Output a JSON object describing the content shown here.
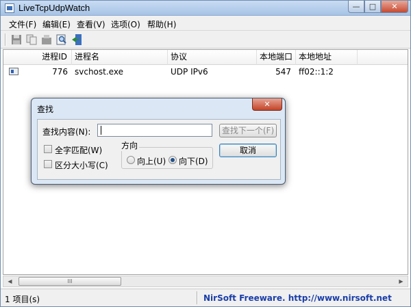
{
  "window": {
    "title": "LiveTcpUdpWatch",
    "minimize_glyph": "—",
    "maximize_glyph": "□",
    "close_glyph": "✕"
  },
  "menu": {
    "items": [
      {
        "label": "文件(F)"
      },
      {
        "label": "编辑(E)"
      },
      {
        "label": "查看(V)"
      },
      {
        "label": "选项(O)"
      },
      {
        "label": "帮助(H)"
      }
    ]
  },
  "toolbar": {
    "icons": [
      "save-icon",
      "copy-icon",
      "properties-icon",
      "find-icon",
      "exit-icon"
    ]
  },
  "list": {
    "columns": [
      "进程ID",
      "进程名",
      "协议",
      "本地端口",
      "本地地址"
    ],
    "rows": [
      {
        "pid": "776",
        "name": "svchost.exe",
        "protocol": "UDP IPv6",
        "local_port": "547",
        "local_address": "ff02::1:2"
      }
    ]
  },
  "scrollbar": {
    "left_arrow": "◀",
    "right_arrow": "▶",
    "thumb_grip": "III"
  },
  "status": {
    "items": "1 项目(s)",
    "link": "NirSoft Freeware.  http://www.nirsoft.net"
  },
  "find_dialog": {
    "title": "查找",
    "close_glyph": "✕",
    "find_label": "查找内容(N):",
    "find_value": "",
    "find_next_label": "查找下一个(F)",
    "cancel_label": "取消",
    "match_whole_word_label": "全字匹配(W)",
    "match_case_label": "区分大小写(C)",
    "direction_title": "方向",
    "direction_up_label": "向上(U)",
    "direction_down_label": "向下(D)",
    "direction_selected": "down"
  },
  "colors": {
    "link": "#1a3ea8",
    "close_button": "#c74a32",
    "title_bar": "#a6c3e6"
  }
}
